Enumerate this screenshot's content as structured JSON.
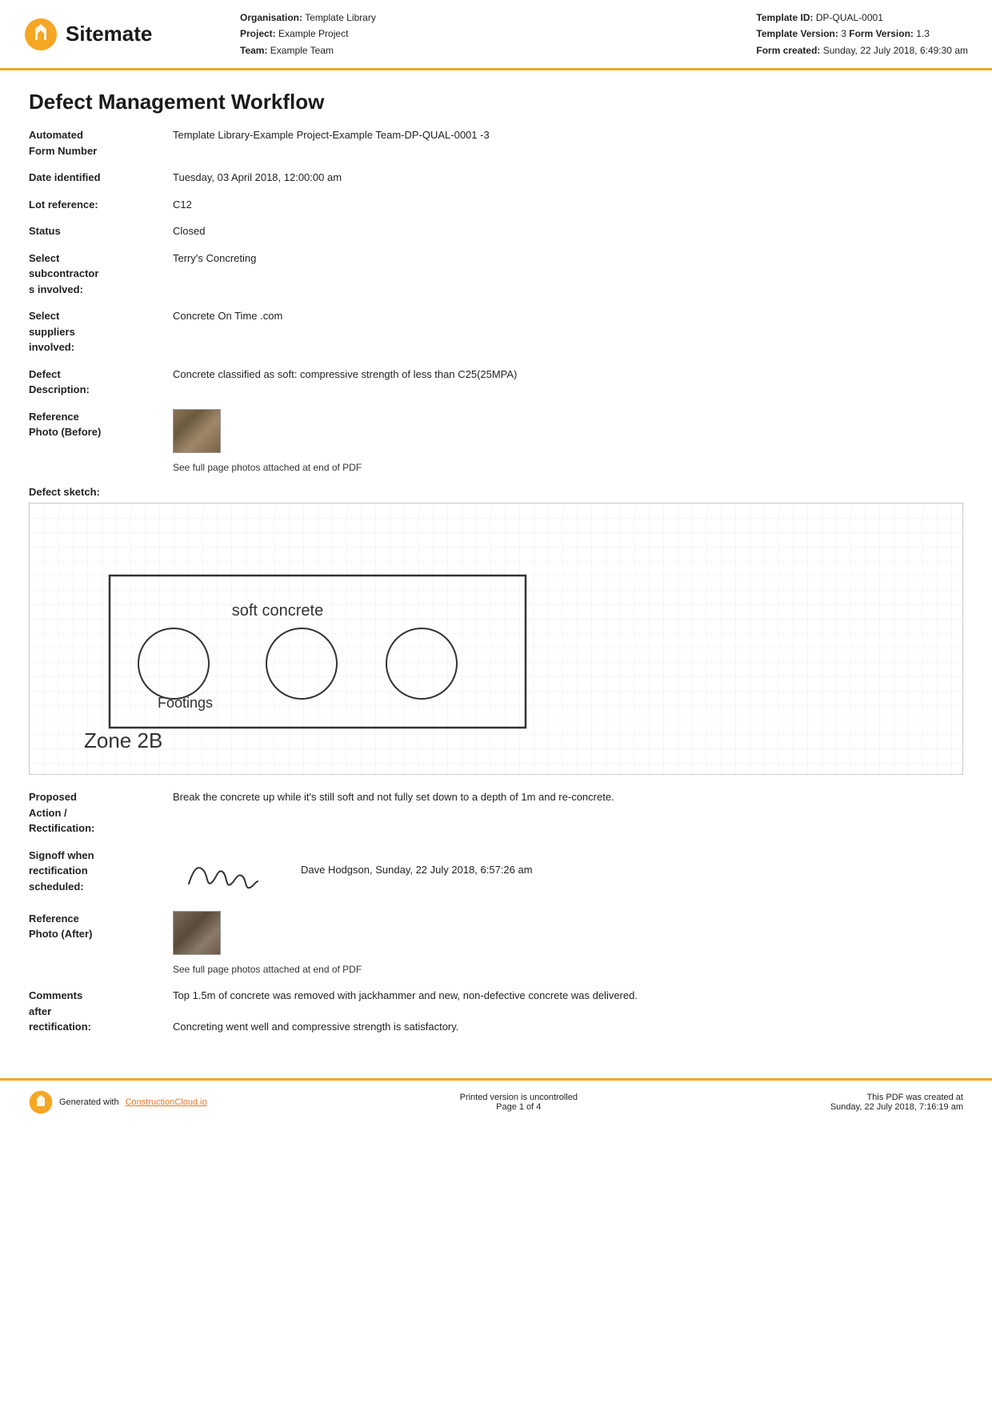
{
  "header": {
    "logo_text": "Sitemate",
    "org_label": "Organisation:",
    "org_value": "Template Library",
    "project_label": "Project:",
    "project_value": "Example Project",
    "team_label": "Team:",
    "team_value": "Example Team",
    "template_id_label": "Template ID:",
    "template_id_value": "DP-QUAL-0001",
    "template_version_label": "Template Version:",
    "template_version_value": "3",
    "form_version_label": "Form Version:",
    "form_version_value": "1.3",
    "form_created_label": "Form created:",
    "form_created_value": "Sunday, 22 July 2018, 6:49:30 am"
  },
  "page": {
    "title": "Defect Management Workflow"
  },
  "fields": {
    "automated_label": "Automated\nForm Number",
    "automated_value": "Template Library-Example Project-Example Team-DP-QUAL-0001   -3",
    "date_label": "Date identified",
    "date_value": "Tuesday, 03 April 2018, 12:00:00 am",
    "lot_label": "Lot reference:",
    "lot_value": "C12",
    "status_label": "Status",
    "status_value": "Closed",
    "subcontractor_label": "Select\nsubcontractor\ns involved:",
    "subcontractor_value": "Terry's Concreting",
    "suppliers_label": "Select\nsuppliers\ninvolved:",
    "suppliers_value": "Concrete On Time .com",
    "defect_label": "Defect\nDescription:",
    "defect_value": "Concrete classified as soft: compressive strength of less than C25(25MPA)",
    "ref_photo_before_label": "Reference\nPhoto (Before)",
    "ref_photo_before_caption": "See full page photos attached at end of PDF",
    "sketch_label": "Defect sketch:",
    "sketch_text1": "soft concrete",
    "sketch_text2": "Footings",
    "sketch_text3": "Zone 2B",
    "proposed_label": "Proposed\nAction /\nRectification:",
    "proposed_value": "Break the concrete up while it's still soft and not fully set down to a depth of 1m and re-concrete.",
    "signoff_label": "Signoff when\nrectification\nscheduled:",
    "signoff_person": "Dave Hodgson, Sunday, 22 July 2018, 6:57:26 am",
    "ref_photo_after_label": "Reference\nPhoto (After)",
    "ref_photo_after_caption": "See full page photos attached at end of PDF",
    "comments_label": "Comments\nafter\nrectification:",
    "comments_value1": "Top 1.5m of concrete was removed with jackhammer and new, non-defective concrete was delivered.",
    "comments_value2": "Concreting went well and compressive strength is satisfactory."
  },
  "footer": {
    "generated_label": "Generated with",
    "generated_link": "ConstructionCloud.io",
    "uncontrolled": "Printed version is uncontrolled",
    "page_label": "Page 1 of 4",
    "pdf_created": "This PDF was created at",
    "pdf_date": "Sunday, 22 July 2018, 7:16:19 am"
  }
}
